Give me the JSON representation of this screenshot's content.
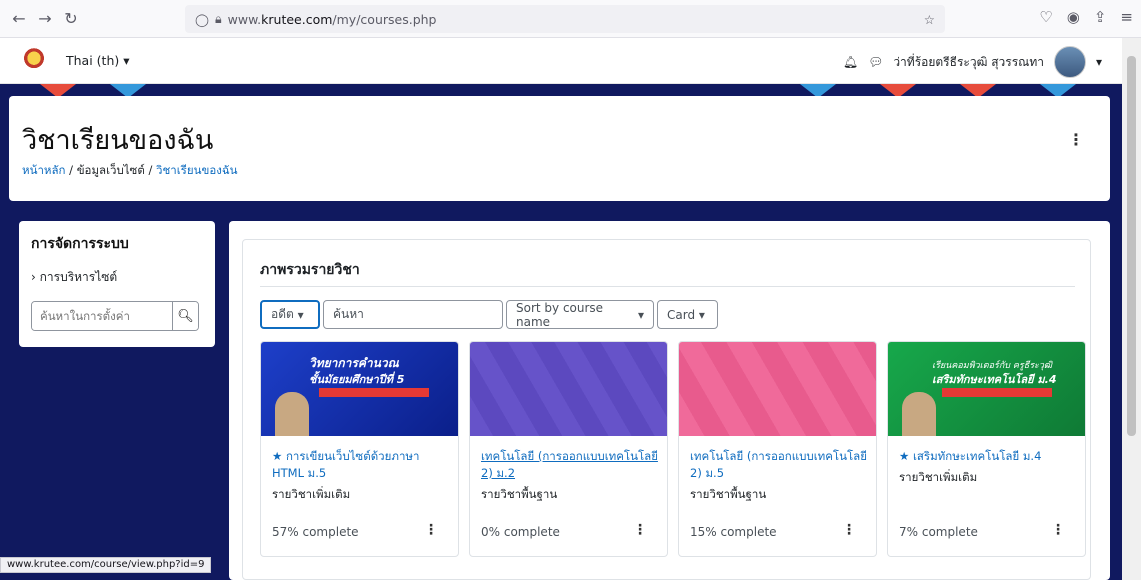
{
  "browser": {
    "url_host": "www.krutee.com",
    "url_path": "/my/courses.php",
    "url_prefix": "www."
  },
  "header": {
    "language": "Thai (th)",
    "user_name": "ว่าที่ร้อยตรีธีระวุฒิ สุวรรณทา"
  },
  "page": {
    "title": "วิชาเรียนของฉัน",
    "breadcrumb": [
      "หน้าหลัก",
      "ข้อมูลเว็บไซต์",
      "วิชาเรียนของฉัน"
    ]
  },
  "admin": {
    "title": "การจัดการระบบ",
    "node": "การบริหารไซต์",
    "search_placeholder": "ค้นหาในการตั้งค่า"
  },
  "overview": {
    "title": "ภาพรวมรายวิชา",
    "filter": "อดีต",
    "search_placeholder": "ค้นหา",
    "sort": "Sort by course name",
    "view": "Card"
  },
  "courses": [
    {
      "starred": true,
      "title": "การเขียนเว็บไซต์ด้วยภาษา HTML ม.5",
      "category": "รายวิชาเพิ่มเติม",
      "progress": "57% complete"
    },
    {
      "starred": false,
      "title": "เทคโนโลยี (การออกแบบเทคโนโลยี 2) ม.2",
      "category": "รายวิชาพื้นฐาน",
      "progress": "0% complete"
    },
    {
      "starred": false,
      "title": "เทคโนโลยี (การออกแบบเทคโนโลยี 2) ม.5",
      "category": "รายวิชาพื้นฐาน",
      "progress": "15% complete"
    },
    {
      "starred": true,
      "title": "เสริมทักษะเทคโนโลยี ม.4",
      "category": "รายวิชาเพิ่มเติม",
      "progress": "7% complete"
    }
  ],
  "course_images": [
    {
      "line1": "วิทยาการคำนวณ",
      "line2": "ชั้นมัธยมศึกษาปีที่ 5"
    },
    {},
    {},
    {
      "line1": "เรียนคอมพิวเตอร์กับ ครูธีระวุฒิ",
      "line2": "เสริมทักษะเทคโนโลยี ม.4"
    }
  ],
  "statusbar": "www.krutee.com/course/view.php?id=9",
  "colors": {
    "brand": "#0f6cbf",
    "background": "#10195f"
  }
}
